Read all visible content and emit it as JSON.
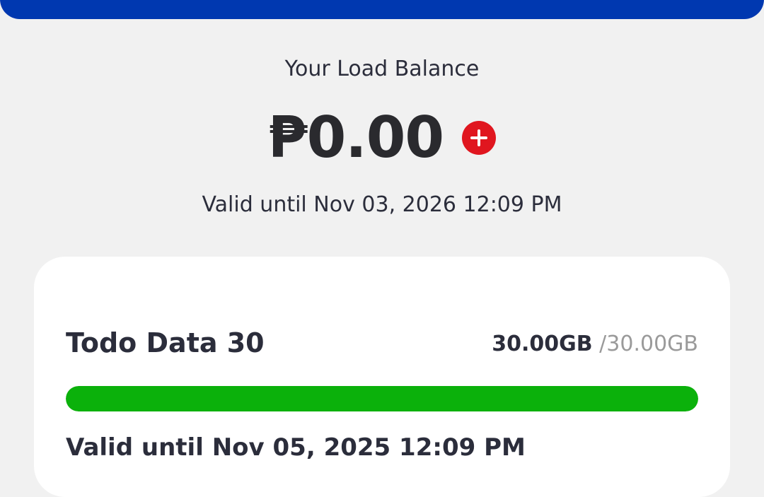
{
  "header": {
    "brand_color": "#0038b0"
  },
  "balance": {
    "label": "Your Load Balance",
    "amount": "₱0.00",
    "add_icon": "plus-icon",
    "add_color": "#e0161f",
    "validity": "Valid until Nov 03, 2026 12:09 PM"
  },
  "promo": {
    "name": "Todo Data 30",
    "remaining": "30.00GB",
    "separator": "/",
    "total": "30.00GB",
    "progress_fraction": 1.0,
    "progress_color": "#0bb10b",
    "validity": "Valid until Nov 05, 2025 12:09 PM"
  }
}
